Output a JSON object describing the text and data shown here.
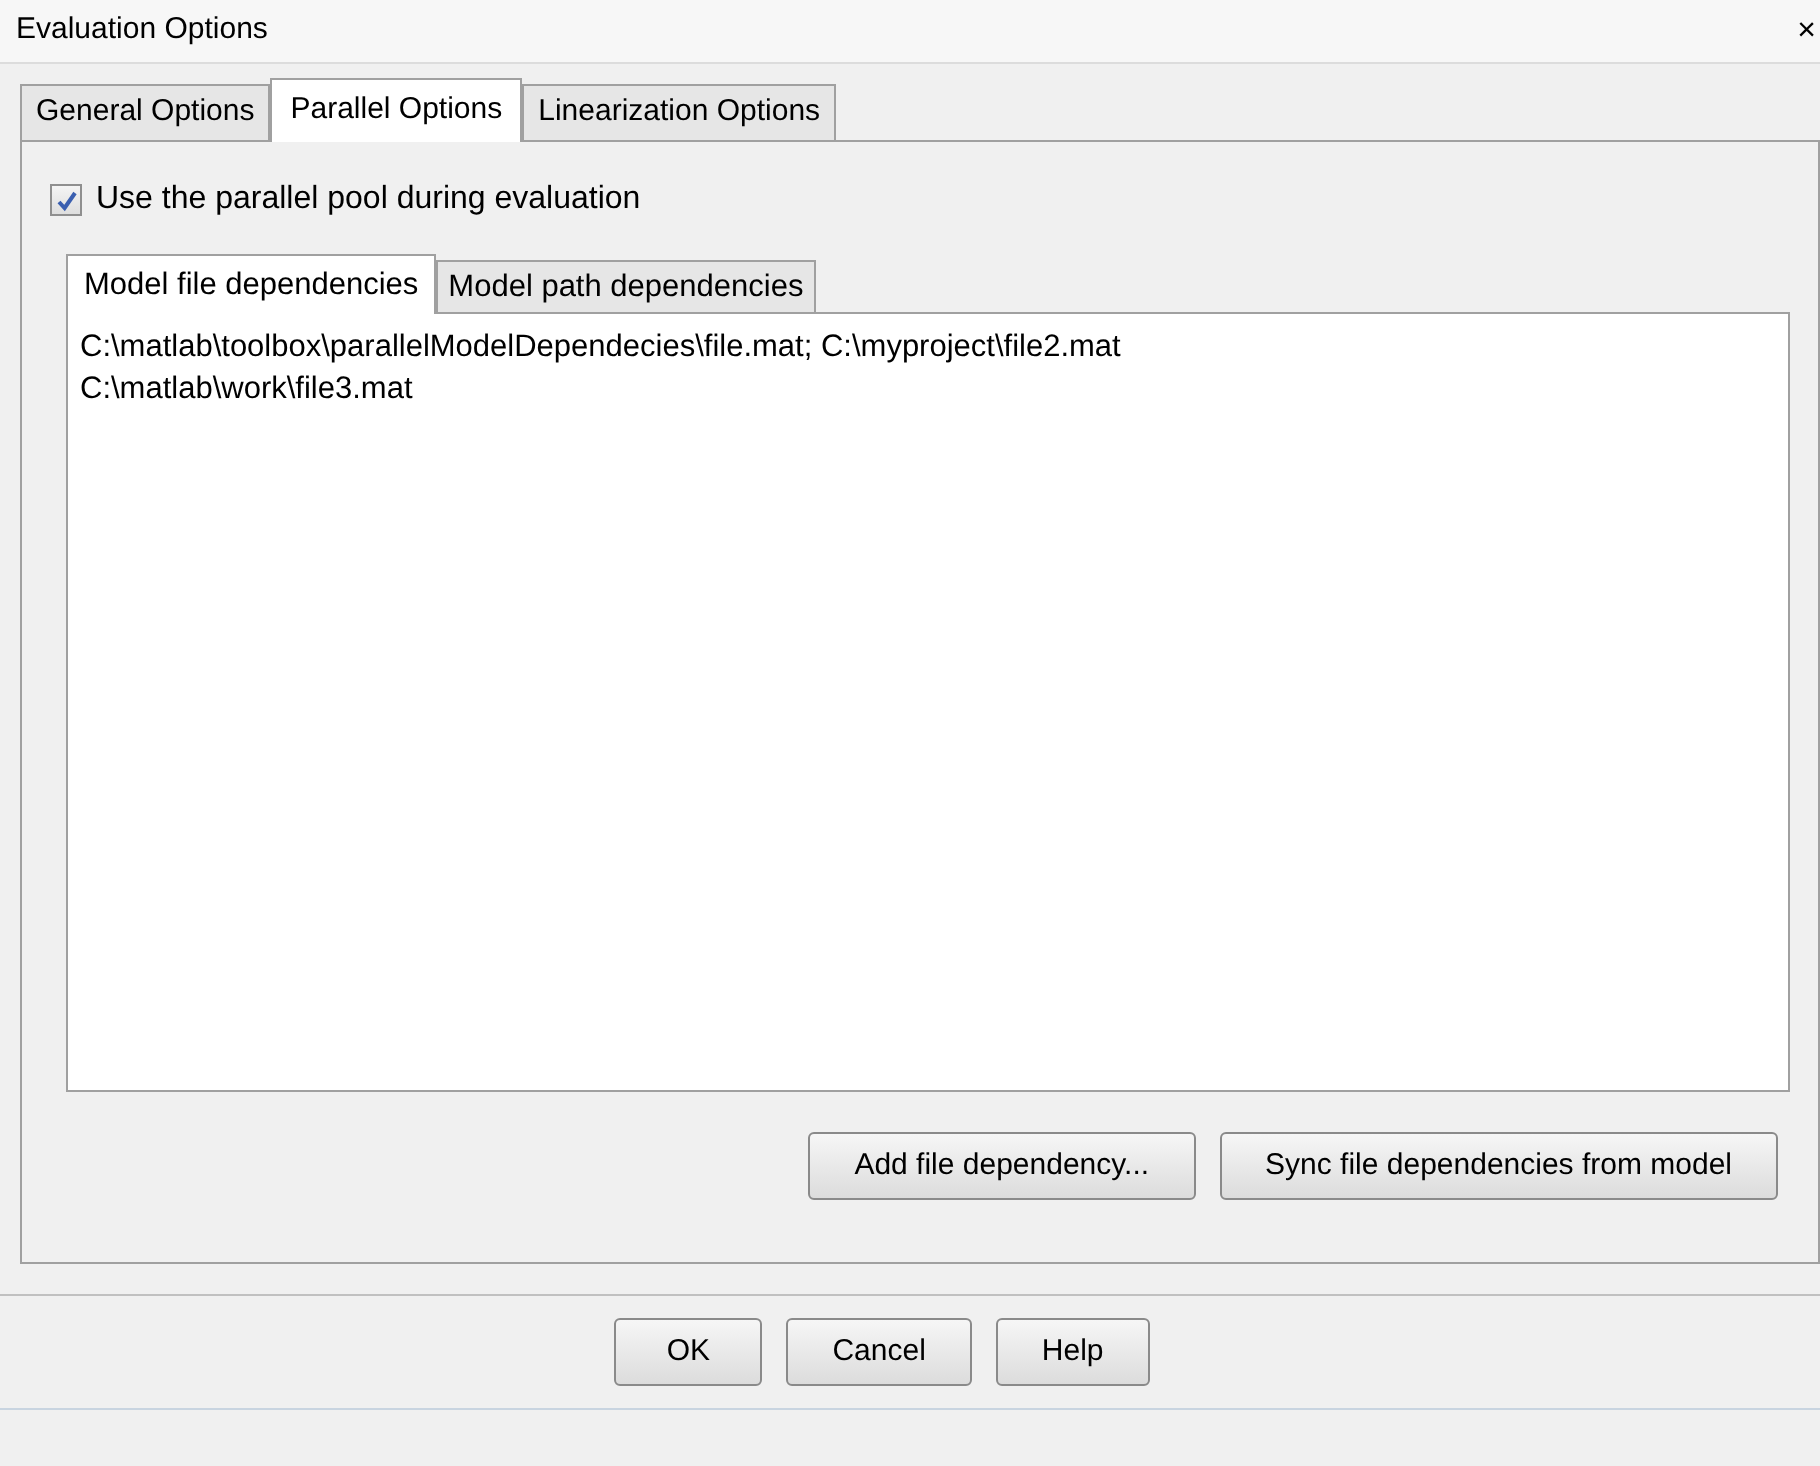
{
  "window": {
    "title": "Evaluation Options",
    "close": "×"
  },
  "tabs": [
    {
      "label": "General Options",
      "selected": false
    },
    {
      "label": "Parallel Options",
      "selected": true
    },
    {
      "label": "Linearization Options",
      "selected": false
    }
  ],
  "use_parallel_pool": {
    "label": "Use the parallel pool during evaluation",
    "checked": true
  },
  "inner_tabs": [
    {
      "label": "Model file dependencies",
      "selected": true
    },
    {
      "label": "Model path dependencies",
      "selected": false
    }
  ],
  "dependencies_text": [
    "C:\\matlab\\toolbox\\parallelModelDependecies\\file.mat; C:\\myproject\\file2.mat",
    "C:\\matlab\\work\\file3.mat"
  ],
  "panel_buttons": [
    "Add file dependency...",
    "Sync file dependencies from model"
  ],
  "dialog_buttons": [
    "OK",
    "Cancel",
    "Help"
  ]
}
